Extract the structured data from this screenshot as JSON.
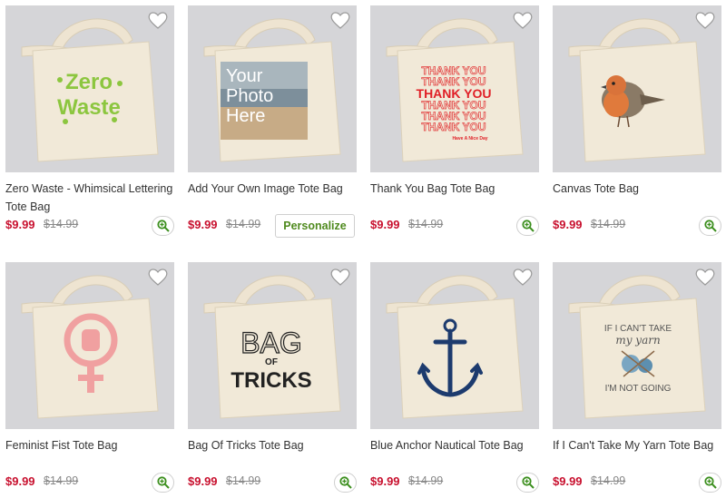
{
  "products": [
    {
      "title": "Zero Waste - Whimsical Lettering Tote Bag",
      "price": "$9.99",
      "old_price": "$14.99",
      "art": "zero-waste"
    },
    {
      "title": "Add Your Own Image Tote Bag",
      "price": "$9.99",
      "old_price": "$14.99",
      "art": "your-photo",
      "personalize_label": "Personalize",
      "art_text": [
        "Your",
        "Photo",
        "Here"
      ]
    },
    {
      "title": "Thank You Bag Tote Bag",
      "price": "$9.99",
      "old_price": "$14.99",
      "art": "thank-you",
      "art_text": [
        "THANK YOU",
        "THANK YOU",
        "THANK YOU",
        "THANK YOU",
        "THANK YOU",
        "THANK YOU",
        "Have A Nice Day"
      ]
    },
    {
      "title": "Canvas Tote Bag",
      "price": "$9.99",
      "old_price": "$14.99",
      "art": "robin"
    },
    {
      "title": "Feminist Fist Tote Bag",
      "price": "$9.99",
      "old_price": "$14.99",
      "art": "feminist-fist"
    },
    {
      "title": "Bag Of Tricks Tote Bag",
      "price": "$9.99",
      "old_price": "$14.99",
      "art": "bag-of-tricks",
      "art_text": [
        "BAG",
        "OF",
        "TRICKS"
      ]
    },
    {
      "title": "Blue Anchor Nautical Tote Bag",
      "price": "$9.99",
      "old_price": "$14.99",
      "art": "anchor"
    },
    {
      "title": "If I Can't Take My Yarn Tote Bag",
      "price": "$9.99",
      "old_price": "$14.99",
      "art": "yarn",
      "art_text": [
        "IF I CAN'T TAKE",
        "my yarn",
        "I'M NOT GOING"
      ]
    }
  ],
  "icons": {
    "favorite": "heart-icon",
    "zoom": "zoom-in-icon"
  },
  "colors": {
    "price": "#c8102e",
    "accent": "#4f8a1e",
    "image_bg": "#d5d5d8",
    "bag": "#f1e9d8"
  }
}
